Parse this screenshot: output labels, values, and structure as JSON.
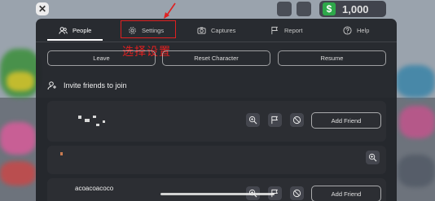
{
  "hud": {
    "close_symbol": "✕",
    "currency_symbol": "$",
    "balance": "1,000"
  },
  "menu": {
    "tabs": [
      {
        "label": "People",
        "icon": "people-icon",
        "active": true
      },
      {
        "label": "Settings",
        "icon": "gear-icon",
        "active": false
      },
      {
        "label": "Captures",
        "icon": "camera-icon",
        "active": false
      },
      {
        "label": "Report",
        "icon": "flag-icon",
        "active": false
      },
      {
        "label": "Help",
        "icon": "question-icon",
        "active": false
      }
    ],
    "annotation": "选择设置",
    "annotation_color": "#e02020",
    "actions": [
      {
        "label": "Leave"
      },
      {
        "label": "Reset Character"
      },
      {
        "label": "Resume"
      }
    ],
    "invite_label": "Invite friends to join",
    "players": [
      {
        "name": "",
        "add_friend_label": "Add Friend",
        "icons": [
          "inspect-icon",
          "report-flag-icon",
          "block-icon"
        ]
      },
      {
        "name": "",
        "icons": [
          "inspect-icon"
        ]
      },
      {
        "name": "acoacoacoco",
        "add_friend_label": "Add Friend",
        "icons": [
          "inspect-icon",
          "report-flag-icon",
          "block-icon"
        ]
      }
    ]
  },
  "colors": {
    "panel": "#212328",
    "card": "#2c2e34",
    "money_icon": "#2ea84a"
  }
}
